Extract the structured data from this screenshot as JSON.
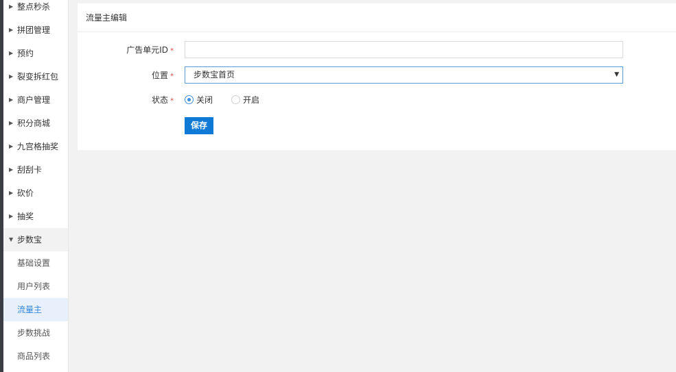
{
  "sidebar": {
    "items": [
      {
        "label": "整点秒杀"
      },
      {
        "label": "拼团管理"
      },
      {
        "label": "预约"
      },
      {
        "label": "裂变拆红包"
      },
      {
        "label": "商户管理"
      },
      {
        "label": "积分商城"
      },
      {
        "label": "九宫格抽奖"
      },
      {
        "label": "刮刮卡"
      },
      {
        "label": "砍价"
      },
      {
        "label": "抽奖"
      },
      {
        "label": "步数宝"
      }
    ],
    "subitems": [
      {
        "label": "基础设置"
      },
      {
        "label": "用户列表"
      },
      {
        "label": "流量主"
      },
      {
        "label": "步数挑战"
      },
      {
        "label": "商品列表"
      }
    ]
  },
  "panel": {
    "title": "流量主编辑"
  },
  "form": {
    "ad_id": {
      "label": "广告单元ID",
      "required": "*",
      "value": ""
    },
    "position": {
      "label": "位置",
      "required": "*",
      "selected": "步数宝首页"
    },
    "status": {
      "label": "状态",
      "required": "*",
      "options": [
        {
          "label": "关闭",
          "checked": true
        },
        {
          "label": "开启",
          "checked": false
        }
      ]
    },
    "save_label": "保存"
  },
  "colors": {
    "accent": "#0e7ad6",
    "active_bg": "#e8f1fb",
    "active_text": "#3388d9",
    "required": "#e64545"
  }
}
